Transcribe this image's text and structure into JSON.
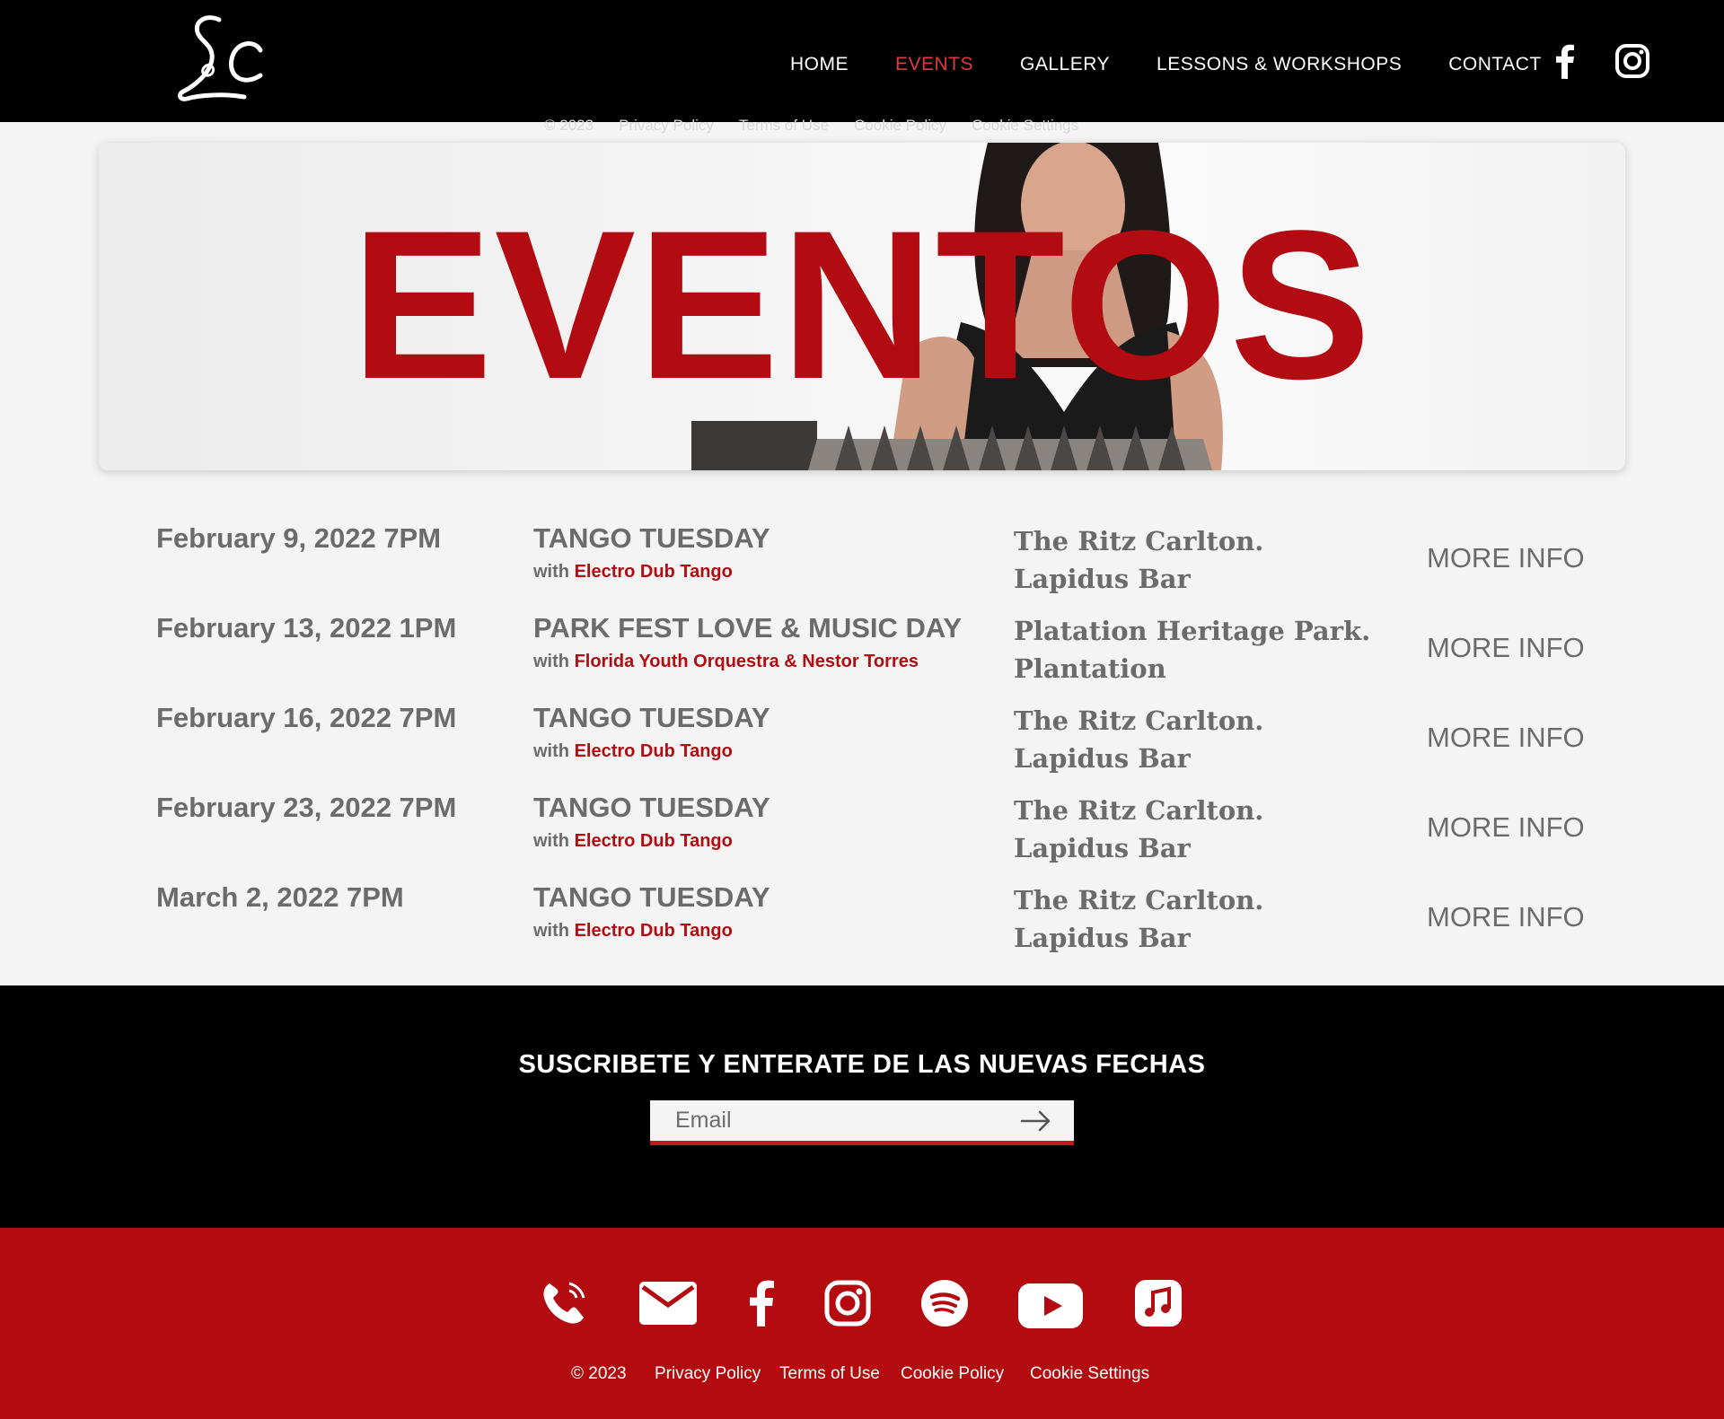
{
  "header": {
    "logo_alt": "SLC",
    "nav": [
      "HOME",
      "EVENTS",
      "GALLERY",
      "LESSONS & WORKSHOPS",
      "CONTACT"
    ],
    "active": "EVENTS"
  },
  "ghost_footer": [
    "© 2023",
    "Privacy Policy",
    "Terms of Use",
    "Cookie Policy",
    "Cookie Settings"
  ],
  "hero": {
    "title": "EVENTOS"
  },
  "events": [
    {
      "date": "February 9, 2022 7PM",
      "name": "TANGO TUESDAY",
      "with": "with",
      "artist": "Electro Dub Tango",
      "venue_1": "The Ritz Carlton.",
      "venue_2": "Lapidus Bar",
      "more": "MORE INFO"
    },
    {
      "date": "February 13, 2022 1PM",
      "name": "PARK FEST LOVE & MUSIC DAY",
      "with": "with",
      "artist": "Florida Youth Orquestra & Nestor Torres",
      "venue_1": "Platation Heritage Park.",
      "venue_2": "Plantation",
      "more": "MORE INFO"
    },
    {
      "date": "February 16, 2022 7PM",
      "name": "TANGO TUESDAY",
      "with": "with",
      "artist": "Electro Dub Tango",
      "venue_1": "The Ritz Carlton.",
      "venue_2": "Lapidus Bar",
      "more": "MORE INFO"
    },
    {
      "date": "February 23, 2022 7PM",
      "name": "TANGO TUESDAY",
      "with": "with",
      "artist": "Electro Dub Tango",
      "venue_1": "The Ritz Carlton.",
      "venue_2": "Lapidus Bar",
      "more": "MORE INFO"
    },
    {
      "date": "March 2, 2022 7PM",
      "name": "TANGO TUESDAY",
      "with": "with",
      "artist": "Electro Dub Tango",
      "venue_1": "The Ritz Carlton.",
      "venue_2": "Lapidus Bar",
      "more": "MORE INFO"
    }
  ],
  "subscribe": {
    "title": "SUSCRIBETE Y ENTERATE DE LAS NUEVAS FECHAS",
    "email_placeholder": "Email"
  },
  "footer": {
    "icons": [
      "phone-icon",
      "mail-icon",
      "facebook-icon",
      "instagram-icon",
      "spotify-icon",
      "youtube-icon",
      "apple-music-icon"
    ],
    "copyright": "© 2023",
    "links": [
      "Privacy Policy",
      "Terms of Use",
      "Cookie Policy",
      "Cookie Settings"
    ]
  },
  "colors": {
    "brand_red": "#b30b12",
    "footer_red": "#b30b0f",
    "text_gray": "#6b6b6b",
    "header_bg": "#000000"
  }
}
